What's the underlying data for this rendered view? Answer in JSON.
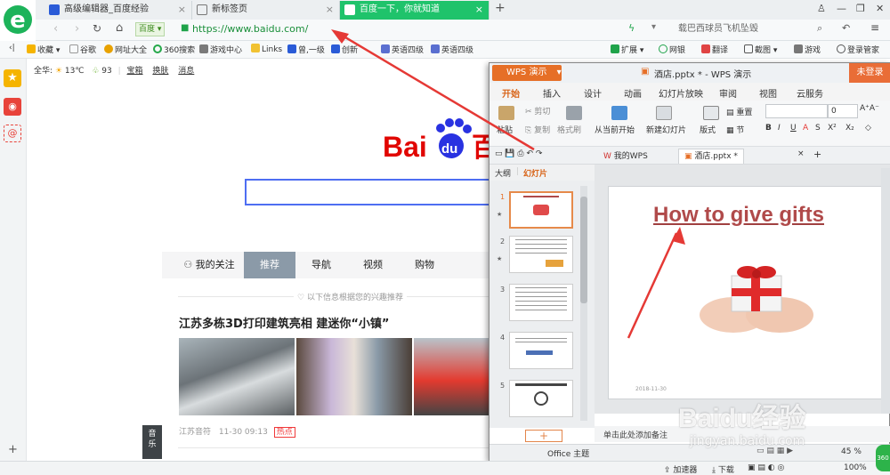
{
  "browser": {
    "tabs": [
      {
        "label": "高级编辑器_百度经验"
      },
      {
        "label": "新标签页"
      },
      {
        "label": "百度一下，你就知道"
      }
    ],
    "mode_label": "百度",
    "url": "https://www.baidu.com/",
    "search_placeholder": "载巴西球员飞机坠毁",
    "bookmarks": [
      "收藏",
      "谷歌",
      "网址大全",
      "360搜索",
      "游戏中心",
      "Links",
      "曾,一级",
      "创新",
      "英语四级",
      "英语四级"
    ],
    "toolbar_right": [
      "扩展",
      "网银",
      "翻译",
      "截图",
      "游戏",
      "登录管家"
    ]
  },
  "baidu": {
    "city": "全华:",
    "temp": "13℃",
    "aqi": "93",
    "links": [
      "宝箱",
      "换肤",
      "消息"
    ],
    "logo_text_bai": "Bai",
    "logo_text_du": "du",
    "logo_text_cn": "百",
    "feed_tabs": [
      "我的关注",
      "推荐",
      "导航",
      "视频",
      "购物"
    ],
    "hint": "以下信息根据您的兴趣推荐",
    "headline": "江苏多栋3D打印建筑亮相 建迷你“小镇”",
    "source": "江苏音符",
    "time": "11-30 09:13",
    "hot_badge": "热点",
    "music_label": "音乐"
  },
  "wps": {
    "app_name": "WPS 演示",
    "doc_title": "酒店.pptx * - WPS 演示",
    "login": "未登录",
    "menu": [
      "开始",
      "插入",
      "设计",
      "动画",
      "幻灯片放映",
      "审阅",
      "视图",
      "云服务"
    ],
    "ribbon": {
      "paste": "粘贴",
      "cut": "剪切",
      "copy": "复制",
      "format_painter": "格式刷",
      "from_current": "从当前开始",
      "new_slide": "新建幻灯片",
      "layout": "版式",
      "reset": "重置",
      "section": "节",
      "font_size": "0"
    },
    "doc_tabs": [
      "我的WPS",
      "酒店.pptx *"
    ],
    "pane_tabs": [
      "大纲",
      "幻灯片"
    ],
    "thumbs": [
      "1",
      "2",
      "3",
      "4",
      "5"
    ],
    "slide_title": "How to give gifts",
    "slide_date": "2018-11-30",
    "notes_placeholder": "单击此处添加备注",
    "theme": "Office 主题",
    "zoom": "45 %"
  },
  "bottom": {
    "accelerator": "加速器",
    "download": "下载",
    "zoom": "100%"
  },
  "watermark": {
    "brand": "Baidu经验",
    "url": "jingyan.baidu.com"
  },
  "colors": {
    "accent_green": "#1fc36b",
    "baidu_blue": "#2932e1",
    "baidu_red": "#e10602",
    "wps_orange": "#e66f27",
    "arrow_red": "#e53935"
  }
}
